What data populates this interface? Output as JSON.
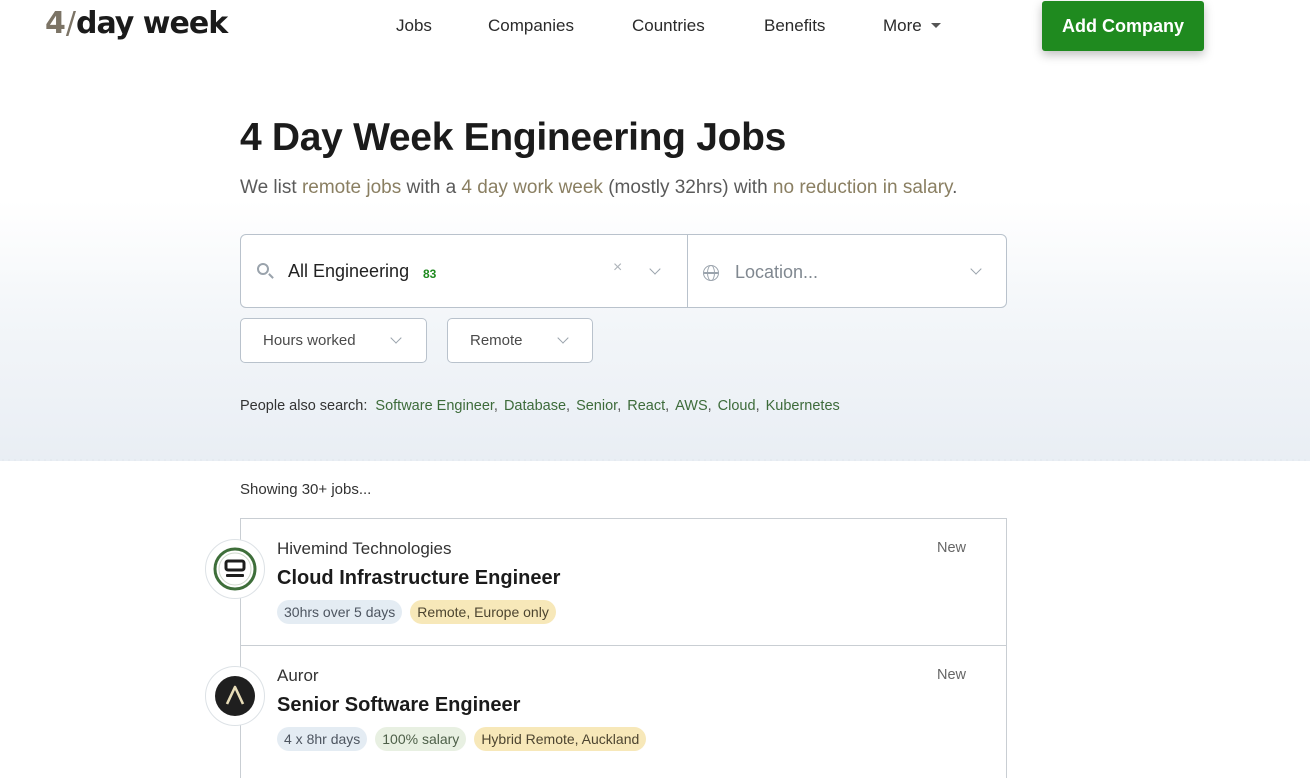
{
  "header": {
    "logo": {
      "four": "4",
      "slash": "/",
      "word": "day week"
    },
    "nav": [
      {
        "label": "Jobs"
      },
      {
        "label": "Companies"
      },
      {
        "label": "Countries"
      },
      {
        "label": "Benefits"
      },
      {
        "label": "More"
      }
    ],
    "add_company_label": "Add Company"
  },
  "hero": {
    "title": "4 Day Week Engineering Jobs",
    "subtitle": {
      "p1": "We list ",
      "l1": "remote jobs",
      "p2": " with a ",
      "l2": "4 day work week",
      "p3": " (mostly 32hrs) with ",
      "l3": "no reduction in salary",
      "p4": "."
    }
  },
  "search": {
    "category_value": "All Engineering",
    "category_count": "83",
    "clear_symbol": "×",
    "location_placeholder": "Location...",
    "location_value": ""
  },
  "filters": [
    {
      "label": "Hours worked"
    },
    {
      "label": "Remote"
    }
  ],
  "also_search": {
    "label": "People also search:",
    "tags": [
      "Software Engineer",
      "Database",
      "Senior",
      "React",
      "AWS",
      "Cloud",
      "Kubernetes"
    ]
  },
  "results": {
    "showing_text": "Showing 30+ jobs...",
    "jobs": [
      {
        "company": "Hivemind Technologies",
        "title": "Cloud Infrastructure Engineer",
        "badges": [
          "30hrs over 5 days",
          "Remote, Europe only"
        ],
        "status": "New"
      },
      {
        "company": "Auror",
        "title": "Senior Software Engineer",
        "badges": [
          "4 x 8hr days",
          "100% salary",
          "Hybrid Remote, Auckland"
        ],
        "status": "New"
      }
    ]
  },
  "colors": {
    "brand_green": "#1f8a1f",
    "link_olive": "#8a7f62",
    "tag_green": "#3d6b3a",
    "badge_remote_bg": "#f7e8b9",
    "badge_hours_bg": "#e4ecf3",
    "badge_salary_bg": "#e8f0e2"
  }
}
